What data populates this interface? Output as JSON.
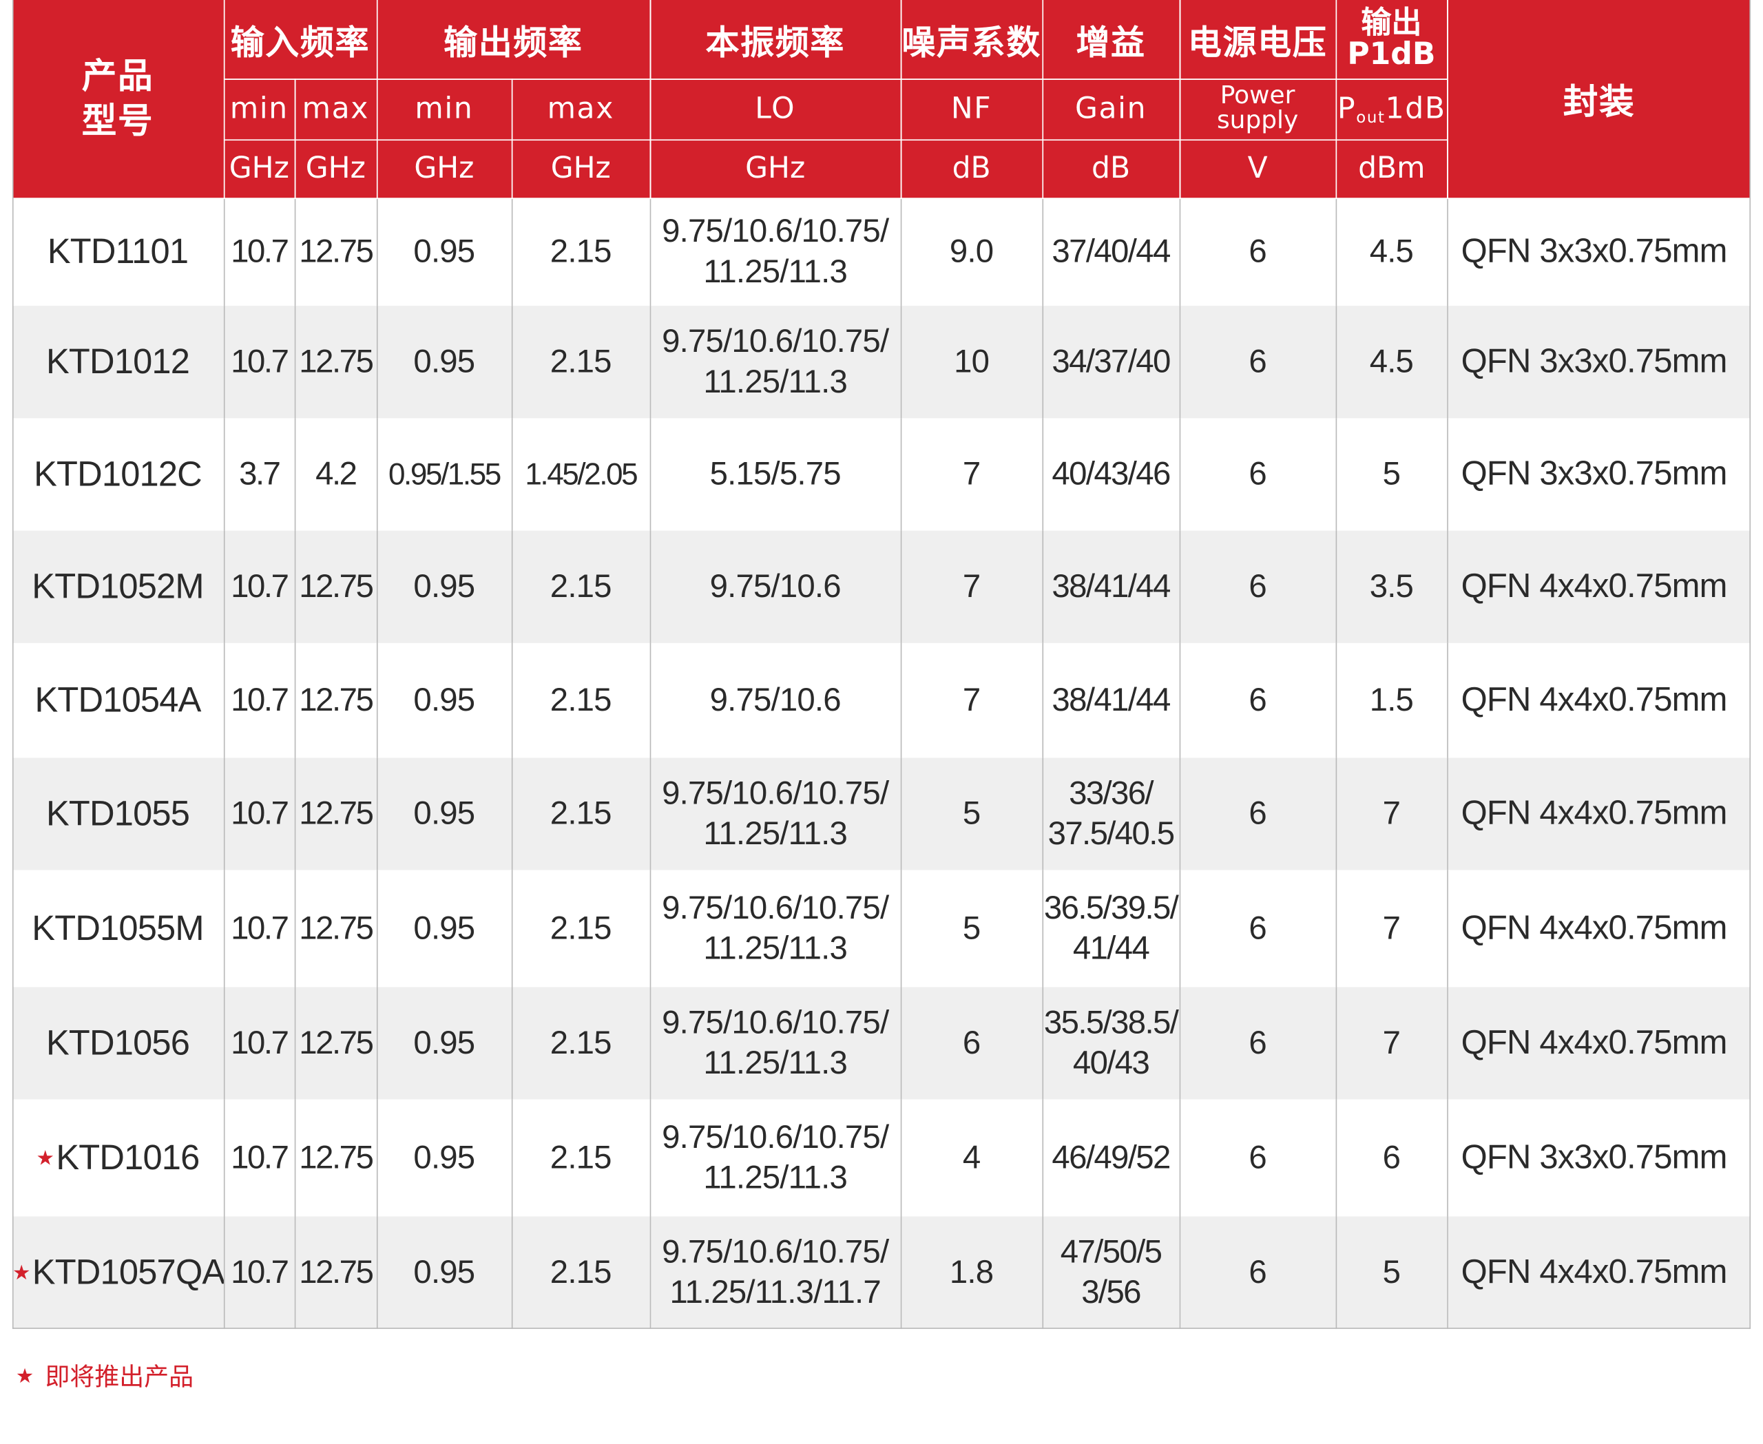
{
  "header": {
    "model": "产品\n型号",
    "input_freq": "输入频率",
    "output_freq": "输出频率",
    "lo_freq": "本振频率",
    "noise_figure": "噪声系数",
    "gain": "增益",
    "supply_voltage": "电源电压",
    "output_p1db_line1": "输出",
    "output_p1db_line2": "P1dB",
    "package": "封装",
    "sub": {
      "in_min": "min",
      "in_max": "max",
      "out_min": "min",
      "out_max": "max",
      "lo": "LO",
      "nf": "NF",
      "gain": "Gain",
      "power_line1": "Power",
      "power_line2": "supply",
      "pout_p": "P",
      "pout_sub": "out",
      "pout_rest": "1dB"
    },
    "units": {
      "in_min": "GHz",
      "in_max": "GHz",
      "out_min": "GHz",
      "out_max": "GHz",
      "lo": "GHz",
      "nf": "dB",
      "gain": "dB",
      "power": "V",
      "pout": "dBm"
    }
  },
  "rows": [
    {
      "model": "KTD1101",
      "star": false,
      "in_min": "10.7",
      "in_max": "12.75",
      "out_min": "0.95",
      "out_max": "2.15",
      "lo_1": "9.75/10.6/10.75/",
      "lo_2": "11.25/11.3",
      "nf": "9.0",
      "gain_1": "37/40/44",
      "gain_2": "",
      "v": "6",
      "p1db": "4.5",
      "pkg": "QFN 3x3x0.75mm"
    },
    {
      "model": "KTD1012",
      "star": false,
      "in_min": "10.7",
      "in_max": "12.75",
      "out_min": "0.95",
      "out_max": "2.15",
      "lo_1": "9.75/10.6/10.75/",
      "lo_2": "11.25/11.3",
      "nf": "10",
      "gain_1": "34/37/40",
      "gain_2": "",
      "v": "6",
      "p1db": "4.5",
      "pkg": "QFN 3x3x0.75mm"
    },
    {
      "model": "KTD1012C",
      "star": false,
      "in_min": "3.7",
      "in_max": "4.2",
      "out_min": "0.95/1.55",
      "out_max": "1.45/2.05",
      "lo_1": "5.15/5.75",
      "lo_2": "",
      "nf": "7",
      "gain_1": "40/43/46",
      "gain_2": "",
      "v": "6",
      "p1db": "5",
      "pkg": "QFN 3x3x0.75mm"
    },
    {
      "model": "KTD1052M",
      "star": false,
      "in_min": "10.7",
      "in_max": "12.75",
      "out_min": "0.95",
      "out_max": "2.15",
      "lo_1": "9.75/10.6",
      "lo_2": "",
      "nf": "7",
      "gain_1": "38/41/44",
      "gain_2": "",
      "v": "6",
      "p1db": "3.5",
      "pkg": "QFN 4x4x0.75mm"
    },
    {
      "model": "KTD1054A",
      "star": false,
      "in_min": "10.7",
      "in_max": "12.75",
      "out_min": "0.95",
      "out_max": "2.15",
      "lo_1": "9.75/10.6",
      "lo_2": "",
      "nf": "7",
      "gain_1": "38/41/44",
      "gain_2": "",
      "v": "6",
      "p1db": "1.5",
      "pkg": "QFN 4x4x0.75mm"
    },
    {
      "model": "KTD1055",
      "star": false,
      "in_min": "10.7",
      "in_max": "12.75",
      "out_min": "0.95",
      "out_max": "2.15",
      "lo_1": "9.75/10.6/10.75/",
      "lo_2": "11.25/11.3",
      "nf": "5",
      "gain_1": "33/36/",
      "gain_2": "37.5/40.5",
      "v": "6",
      "p1db": "7",
      "pkg": "QFN 4x4x0.75mm"
    },
    {
      "model": "KTD1055M",
      "star": false,
      "in_min": "10.7",
      "in_max": "12.75",
      "out_min": "0.95",
      "out_max": "2.15",
      "lo_1": "9.75/10.6/10.75/",
      "lo_2": "11.25/11.3",
      "nf": "5",
      "gain_1": "36.5/39.5/",
      "gain_2": "41/44",
      "v": "6",
      "p1db": "7",
      "pkg": "QFN 4x4x0.75mm"
    },
    {
      "model": "KTD1056",
      "star": false,
      "in_min": "10.7",
      "in_max": "12.75",
      "out_min": "0.95",
      "out_max": "2.15",
      "lo_1": "9.75/10.6/10.75/",
      "lo_2": "11.25/11.3",
      "nf": "6",
      "gain_1": "35.5/38.5/",
      "gain_2": "40/43",
      "v": "6",
      "p1db": "7",
      "pkg": "QFN 4x4x0.75mm"
    },
    {
      "model": "KTD1016",
      "star": true,
      "in_min": "10.7",
      "in_max": "12.75",
      "out_min": "0.95",
      "out_max": "2.15",
      "lo_1": "9.75/10.6/10.75/",
      "lo_2": "11.25/11.3",
      "nf": "4",
      "gain_1": "46/49/52",
      "gain_2": "",
      "v": "6",
      "p1db": "6",
      "pkg": "QFN 3x3x0.75mm"
    },
    {
      "model": "KTD1057QA",
      "star": true,
      "in_min": "10.7",
      "in_max": "12.75",
      "out_min": "0.95",
      "out_max": "2.15",
      "lo_1": "9.75/10.6/10.75/",
      "lo_2": "11.25/11.3/11.7",
      "nf": "1.8",
      "gain_1": "47/50/5",
      "gain_2": "3/56",
      "v": "6",
      "p1db": "5",
      "pkg": "QFN 4x4x0.75mm"
    }
  ],
  "footnote": {
    "star": "★",
    "text": "即将推出产品"
  },
  "colors": {
    "header_red": "#d3202b",
    "row_shade": "#efefef",
    "grid_line": "#b9b9b9"
  }
}
